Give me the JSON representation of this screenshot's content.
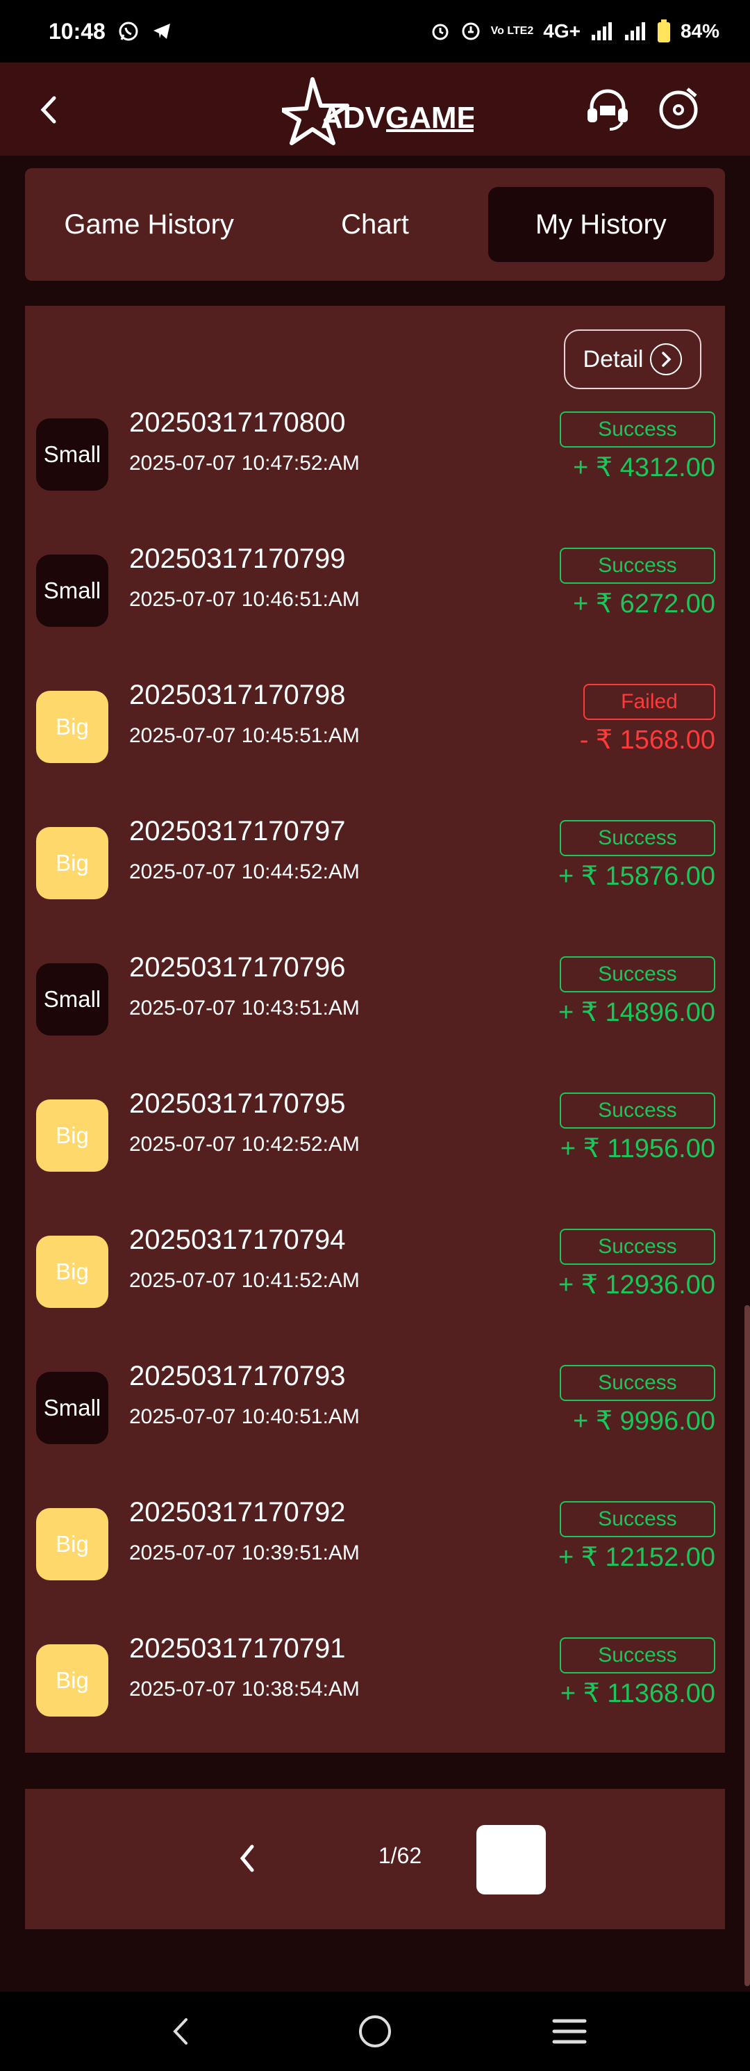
{
  "status_bar": {
    "time": "10:48",
    "network": "4G+",
    "volte": "Vo LTE2",
    "battery": "84%"
  },
  "header": {
    "logo_text": "ADVGAME"
  },
  "tabs": [
    {
      "label": "Game History",
      "active": false
    },
    {
      "label": "Chart",
      "active": false
    },
    {
      "label": "My History",
      "active": true
    }
  ],
  "detail_button": {
    "label": "Detail"
  },
  "history": [
    {
      "type": "Small",
      "period": "20250317170800",
      "time": "2025-07-07 10:47:52:AM",
      "status": "Success",
      "amount": "+ ₹ 4312.00"
    },
    {
      "type": "Small",
      "period": "20250317170799",
      "time": "2025-07-07 10:46:51:AM",
      "status": "Success",
      "amount": "+ ₹ 6272.00"
    },
    {
      "type": "Big",
      "period": "20250317170798",
      "time": "2025-07-07 10:45:51:AM",
      "status": "Failed",
      "amount": "- ₹ 1568.00"
    },
    {
      "type": "Big",
      "period": "20250317170797",
      "time": "2025-07-07 10:44:52:AM",
      "status": "Success",
      "amount": "+ ₹ 15876.00"
    },
    {
      "type": "Small",
      "period": "20250317170796",
      "time": "2025-07-07 10:43:51:AM",
      "status": "Success",
      "amount": "+ ₹ 14896.00"
    },
    {
      "type": "Big",
      "period": "20250317170795",
      "time": "2025-07-07 10:42:52:AM",
      "status": "Success",
      "amount": "+ ₹ 11956.00"
    },
    {
      "type": "Big",
      "period": "20250317170794",
      "time": "2025-07-07 10:41:52:AM",
      "status": "Success",
      "amount": "+ ₹ 12936.00"
    },
    {
      "type": "Small",
      "period": "20250317170793",
      "time": "2025-07-07 10:40:51:AM",
      "status": "Success",
      "amount": "+ ₹ 9996.00"
    },
    {
      "type": "Big",
      "period": "20250317170792",
      "time": "2025-07-07 10:39:51:AM",
      "status": "Success",
      "amount": "+ ₹ 12152.00"
    },
    {
      "type": "Big",
      "period": "20250317170791",
      "time": "2025-07-07 10:38:54:AM",
      "status": "Success",
      "amount": "+ ₹ 11368.00"
    }
  ],
  "pagination": {
    "label": "1/62"
  },
  "colors": {
    "success": "#19c75a",
    "failed": "#ff3a3a",
    "big_badge": "#ffd86b",
    "small_badge": "#1c0607",
    "panel": "#531f1f",
    "header": "#3c1010"
  },
  "icons": {
    "back": "chevron-left-icon",
    "support": "headset-icon",
    "music": "music-disc-icon",
    "detail": "chevron-right-circle-icon",
    "nav_back": "nav-back-icon",
    "nav_home": "nav-home-icon",
    "nav_menu": "nav-menu-icon"
  }
}
